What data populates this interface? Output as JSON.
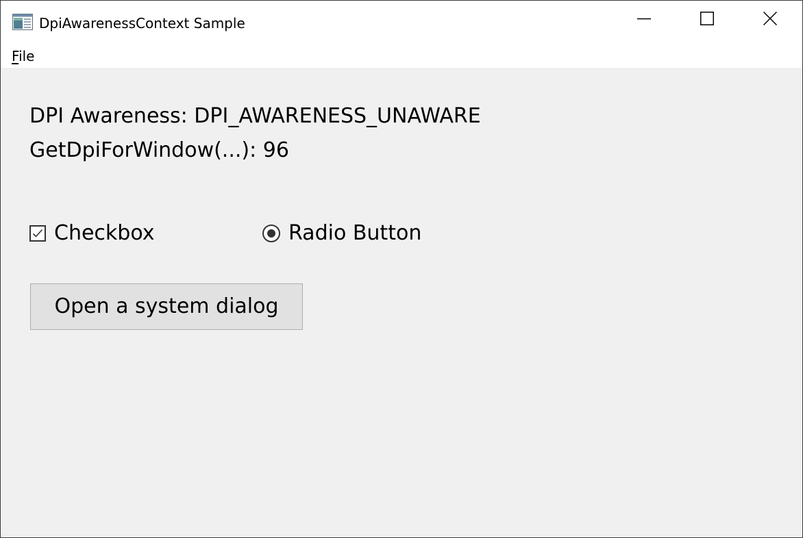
{
  "window": {
    "title": "DpiAwarenessContext Sample",
    "icon": "app-window-icon",
    "controls": {
      "minimize": "minimize-icon",
      "maximize": "maximize-icon",
      "close": "close-icon"
    }
  },
  "menubar": {
    "items": [
      {
        "accel": "F",
        "rest": "ile"
      }
    ]
  },
  "content": {
    "dpi_awareness": "DPI Awareness: DPI_AWARENESS_UNAWARE",
    "dpi_for_window": "GetDpiForWindow(...): 96",
    "checkbox": {
      "label": "Checkbox",
      "checked": true
    },
    "radio": {
      "label": "Radio Button",
      "selected": true
    },
    "button_label": "Open a system dialog"
  },
  "colors": {
    "client_background": "#f0f0f0",
    "button_face": "#e1e1e1",
    "button_border": "#adadad"
  }
}
